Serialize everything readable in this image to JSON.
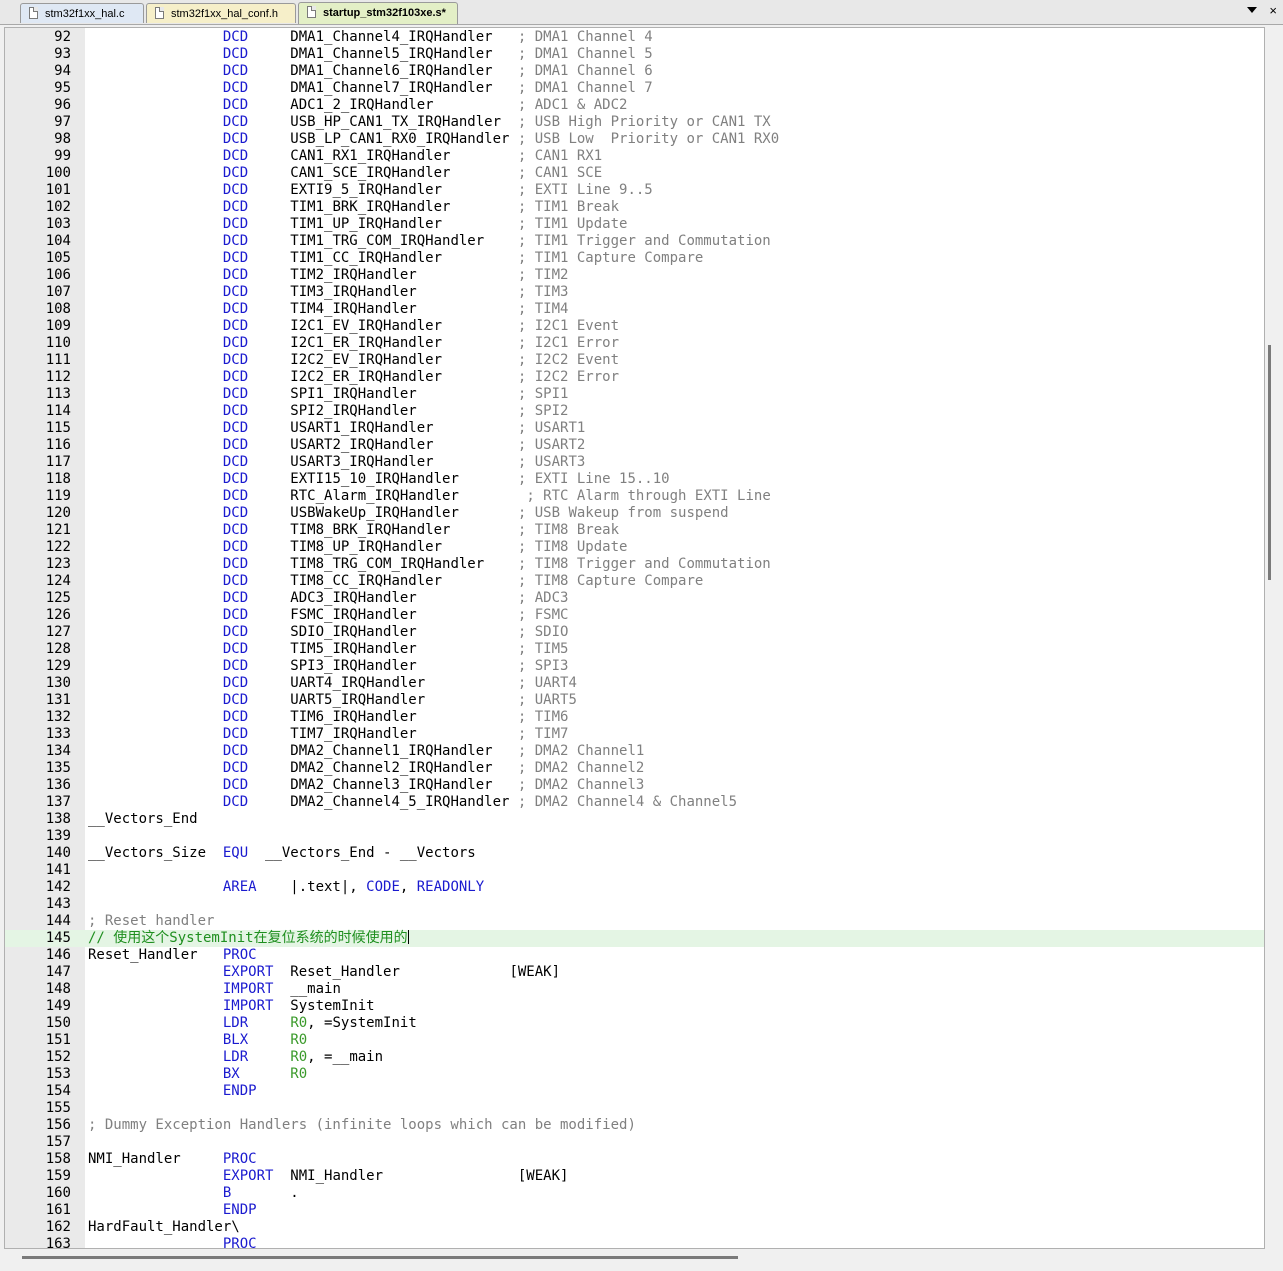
{
  "tabs": [
    {
      "label": "stm32f1xx_hal.c"
    },
    {
      "label": "stm32f1xx_hal_conf.h"
    },
    {
      "label": "startup_stm32f103xe.s*"
    }
  ],
  "current_line": 145,
  "lines": [
    {
      "n": "92",
      "s": [
        {
          "t": "                "
        },
        {
          "t": "DCD",
          "c": "kw"
        },
        {
          "t": "     DMA1_Channel4_IRQHandler   "
        },
        {
          "t": "; DMA1 Channel 4",
          "c": "cm"
        }
      ]
    },
    {
      "n": "93",
      "s": [
        {
          "t": "                "
        },
        {
          "t": "DCD",
          "c": "kw"
        },
        {
          "t": "     DMA1_Channel5_IRQHandler   "
        },
        {
          "t": "; DMA1 Channel 5",
          "c": "cm"
        }
      ]
    },
    {
      "n": "94",
      "s": [
        {
          "t": "                "
        },
        {
          "t": "DCD",
          "c": "kw"
        },
        {
          "t": "     DMA1_Channel6_IRQHandler   "
        },
        {
          "t": "; DMA1 Channel 6",
          "c": "cm"
        }
      ]
    },
    {
      "n": "95",
      "s": [
        {
          "t": "                "
        },
        {
          "t": "DCD",
          "c": "kw"
        },
        {
          "t": "     DMA1_Channel7_IRQHandler   "
        },
        {
          "t": "; DMA1 Channel 7",
          "c": "cm"
        }
      ]
    },
    {
      "n": "96",
      "s": [
        {
          "t": "                "
        },
        {
          "t": "DCD",
          "c": "kw"
        },
        {
          "t": "     ADC1_2_IRQHandler          "
        },
        {
          "t": "; ADC1 & ADC2",
          "c": "cm"
        }
      ]
    },
    {
      "n": "97",
      "s": [
        {
          "t": "                "
        },
        {
          "t": "DCD",
          "c": "kw"
        },
        {
          "t": "     USB_HP_CAN1_TX_IRQHandler  "
        },
        {
          "t": "; USB High Priority or CAN1 TX",
          "c": "cm"
        }
      ]
    },
    {
      "n": "98",
      "s": [
        {
          "t": "                "
        },
        {
          "t": "DCD",
          "c": "kw"
        },
        {
          "t": "     USB_LP_CAN1_RX0_IRQHandler "
        },
        {
          "t": "; USB Low  Priority or CAN1 RX0",
          "c": "cm"
        }
      ]
    },
    {
      "n": "99",
      "s": [
        {
          "t": "                "
        },
        {
          "t": "DCD",
          "c": "kw"
        },
        {
          "t": "     CAN1_RX1_IRQHandler        "
        },
        {
          "t": "; CAN1 RX1",
          "c": "cm"
        }
      ]
    },
    {
      "n": "100",
      "s": [
        {
          "t": "                "
        },
        {
          "t": "DCD",
          "c": "kw"
        },
        {
          "t": "     CAN1_SCE_IRQHandler        "
        },
        {
          "t": "; CAN1 SCE",
          "c": "cm"
        }
      ]
    },
    {
      "n": "101",
      "s": [
        {
          "t": "                "
        },
        {
          "t": "DCD",
          "c": "kw"
        },
        {
          "t": "     EXTI9_5_IRQHandler         "
        },
        {
          "t": "; EXTI Line 9..5",
          "c": "cm"
        }
      ]
    },
    {
      "n": "102",
      "s": [
        {
          "t": "                "
        },
        {
          "t": "DCD",
          "c": "kw"
        },
        {
          "t": "     TIM1_BRK_IRQHandler        "
        },
        {
          "t": "; TIM1 Break",
          "c": "cm"
        }
      ]
    },
    {
      "n": "103",
      "s": [
        {
          "t": "                "
        },
        {
          "t": "DCD",
          "c": "kw"
        },
        {
          "t": "     TIM1_UP_IRQHandler         "
        },
        {
          "t": "; TIM1 Update",
          "c": "cm"
        }
      ]
    },
    {
      "n": "104",
      "s": [
        {
          "t": "                "
        },
        {
          "t": "DCD",
          "c": "kw"
        },
        {
          "t": "     TIM1_TRG_COM_IRQHandler    "
        },
        {
          "t": "; TIM1 Trigger and Commutation",
          "c": "cm"
        }
      ]
    },
    {
      "n": "105",
      "s": [
        {
          "t": "                "
        },
        {
          "t": "DCD",
          "c": "kw"
        },
        {
          "t": "     TIM1_CC_IRQHandler         "
        },
        {
          "t": "; TIM1 Capture Compare",
          "c": "cm"
        }
      ]
    },
    {
      "n": "106",
      "s": [
        {
          "t": "                "
        },
        {
          "t": "DCD",
          "c": "kw"
        },
        {
          "t": "     TIM2_IRQHandler            "
        },
        {
          "t": "; TIM2",
          "c": "cm"
        }
      ]
    },
    {
      "n": "107",
      "s": [
        {
          "t": "                "
        },
        {
          "t": "DCD",
          "c": "kw"
        },
        {
          "t": "     TIM3_IRQHandler            "
        },
        {
          "t": "; TIM3",
          "c": "cm"
        }
      ]
    },
    {
      "n": "108",
      "s": [
        {
          "t": "                "
        },
        {
          "t": "DCD",
          "c": "kw"
        },
        {
          "t": "     TIM4_IRQHandler            "
        },
        {
          "t": "; TIM4",
          "c": "cm"
        }
      ]
    },
    {
      "n": "109",
      "s": [
        {
          "t": "                "
        },
        {
          "t": "DCD",
          "c": "kw"
        },
        {
          "t": "     I2C1_EV_IRQHandler         "
        },
        {
          "t": "; I2C1 Event",
          "c": "cm"
        }
      ]
    },
    {
      "n": "110",
      "s": [
        {
          "t": "                "
        },
        {
          "t": "DCD",
          "c": "kw"
        },
        {
          "t": "     I2C1_ER_IRQHandler         "
        },
        {
          "t": "; I2C1 Error",
          "c": "cm"
        }
      ]
    },
    {
      "n": "111",
      "s": [
        {
          "t": "                "
        },
        {
          "t": "DCD",
          "c": "kw"
        },
        {
          "t": "     I2C2_EV_IRQHandler         "
        },
        {
          "t": "; I2C2 Event",
          "c": "cm"
        }
      ]
    },
    {
      "n": "112",
      "s": [
        {
          "t": "                "
        },
        {
          "t": "DCD",
          "c": "kw"
        },
        {
          "t": "     I2C2_ER_IRQHandler         "
        },
        {
          "t": "; I2C2 Error",
          "c": "cm"
        }
      ]
    },
    {
      "n": "113",
      "s": [
        {
          "t": "                "
        },
        {
          "t": "DCD",
          "c": "kw"
        },
        {
          "t": "     SPI1_IRQHandler            "
        },
        {
          "t": "; SPI1",
          "c": "cm"
        }
      ]
    },
    {
      "n": "114",
      "s": [
        {
          "t": "                "
        },
        {
          "t": "DCD",
          "c": "kw"
        },
        {
          "t": "     SPI2_IRQHandler            "
        },
        {
          "t": "; SPI2",
          "c": "cm"
        }
      ]
    },
    {
      "n": "115",
      "s": [
        {
          "t": "                "
        },
        {
          "t": "DCD",
          "c": "kw"
        },
        {
          "t": "     USART1_IRQHandler          "
        },
        {
          "t": "; USART1",
          "c": "cm"
        }
      ]
    },
    {
      "n": "116",
      "s": [
        {
          "t": "                "
        },
        {
          "t": "DCD",
          "c": "kw"
        },
        {
          "t": "     USART2_IRQHandler          "
        },
        {
          "t": "; USART2",
          "c": "cm"
        }
      ]
    },
    {
      "n": "117",
      "s": [
        {
          "t": "                "
        },
        {
          "t": "DCD",
          "c": "kw"
        },
        {
          "t": "     USART3_IRQHandler          "
        },
        {
          "t": "; USART3",
          "c": "cm"
        }
      ]
    },
    {
      "n": "118",
      "s": [
        {
          "t": "                "
        },
        {
          "t": "DCD",
          "c": "kw"
        },
        {
          "t": "     EXTI15_10_IRQHandler       "
        },
        {
          "t": "; EXTI Line 15..10",
          "c": "cm"
        }
      ]
    },
    {
      "n": "119",
      "s": [
        {
          "t": "                "
        },
        {
          "t": "DCD",
          "c": "kw"
        },
        {
          "t": "     RTC_Alarm_IRQHandler        "
        },
        {
          "t": "; RTC Alarm through EXTI Line",
          "c": "cm"
        }
      ]
    },
    {
      "n": "120",
      "s": [
        {
          "t": "                "
        },
        {
          "t": "DCD",
          "c": "kw"
        },
        {
          "t": "     USBWakeUp_IRQHandler       "
        },
        {
          "t": "; USB Wakeup from suspend",
          "c": "cm"
        }
      ]
    },
    {
      "n": "121",
      "s": [
        {
          "t": "                "
        },
        {
          "t": "DCD",
          "c": "kw"
        },
        {
          "t": "     TIM8_BRK_IRQHandler        "
        },
        {
          "t": "; TIM8 Break",
          "c": "cm"
        }
      ]
    },
    {
      "n": "122",
      "s": [
        {
          "t": "                "
        },
        {
          "t": "DCD",
          "c": "kw"
        },
        {
          "t": "     TIM8_UP_IRQHandler         "
        },
        {
          "t": "; TIM8 Update",
          "c": "cm"
        }
      ]
    },
    {
      "n": "123",
      "s": [
        {
          "t": "                "
        },
        {
          "t": "DCD",
          "c": "kw"
        },
        {
          "t": "     TIM8_TRG_COM_IRQHandler    "
        },
        {
          "t": "; TIM8 Trigger and Commutation",
          "c": "cm"
        }
      ]
    },
    {
      "n": "124",
      "s": [
        {
          "t": "                "
        },
        {
          "t": "DCD",
          "c": "kw"
        },
        {
          "t": "     TIM8_CC_IRQHandler         "
        },
        {
          "t": "; TIM8 Capture Compare",
          "c": "cm"
        }
      ]
    },
    {
      "n": "125",
      "s": [
        {
          "t": "                "
        },
        {
          "t": "DCD",
          "c": "kw"
        },
        {
          "t": "     ADC3_IRQHandler            "
        },
        {
          "t": "; ADC3",
          "c": "cm"
        }
      ]
    },
    {
      "n": "126",
      "s": [
        {
          "t": "                "
        },
        {
          "t": "DCD",
          "c": "kw"
        },
        {
          "t": "     FSMC_IRQHandler            "
        },
        {
          "t": "; FSMC",
          "c": "cm"
        }
      ]
    },
    {
      "n": "127",
      "s": [
        {
          "t": "                "
        },
        {
          "t": "DCD",
          "c": "kw"
        },
        {
          "t": "     SDIO_IRQHandler            "
        },
        {
          "t": "; SDIO",
          "c": "cm"
        }
      ]
    },
    {
      "n": "128",
      "s": [
        {
          "t": "                "
        },
        {
          "t": "DCD",
          "c": "kw"
        },
        {
          "t": "     TIM5_IRQHandler            "
        },
        {
          "t": "; TIM5",
          "c": "cm"
        }
      ]
    },
    {
      "n": "129",
      "s": [
        {
          "t": "                "
        },
        {
          "t": "DCD",
          "c": "kw"
        },
        {
          "t": "     SPI3_IRQHandler            "
        },
        {
          "t": "; SPI3",
          "c": "cm"
        }
      ]
    },
    {
      "n": "130",
      "s": [
        {
          "t": "                "
        },
        {
          "t": "DCD",
          "c": "kw"
        },
        {
          "t": "     UART4_IRQHandler           "
        },
        {
          "t": "; UART4",
          "c": "cm"
        }
      ]
    },
    {
      "n": "131",
      "s": [
        {
          "t": "                "
        },
        {
          "t": "DCD",
          "c": "kw"
        },
        {
          "t": "     UART5_IRQHandler           "
        },
        {
          "t": "; UART5",
          "c": "cm"
        }
      ]
    },
    {
      "n": "132",
      "s": [
        {
          "t": "                "
        },
        {
          "t": "DCD",
          "c": "kw"
        },
        {
          "t": "     TIM6_IRQHandler            "
        },
        {
          "t": "; TIM6",
          "c": "cm"
        }
      ]
    },
    {
      "n": "133",
      "s": [
        {
          "t": "                "
        },
        {
          "t": "DCD",
          "c": "kw"
        },
        {
          "t": "     TIM7_IRQHandler            "
        },
        {
          "t": "; TIM7",
          "c": "cm"
        }
      ]
    },
    {
      "n": "134",
      "s": [
        {
          "t": "                "
        },
        {
          "t": "DCD",
          "c": "kw"
        },
        {
          "t": "     DMA2_Channel1_IRQHandler   "
        },
        {
          "t": "; DMA2 Channel1",
          "c": "cm"
        }
      ]
    },
    {
      "n": "135",
      "s": [
        {
          "t": "                "
        },
        {
          "t": "DCD",
          "c": "kw"
        },
        {
          "t": "     DMA2_Channel2_IRQHandler   "
        },
        {
          "t": "; DMA2 Channel2",
          "c": "cm"
        }
      ]
    },
    {
      "n": "136",
      "s": [
        {
          "t": "                "
        },
        {
          "t": "DCD",
          "c": "kw"
        },
        {
          "t": "     DMA2_Channel3_IRQHandler   "
        },
        {
          "t": "; DMA2 Channel3",
          "c": "cm"
        }
      ]
    },
    {
      "n": "137",
      "s": [
        {
          "t": "                "
        },
        {
          "t": "DCD",
          "c": "kw"
        },
        {
          "t": "     DMA2_Channel4_5_IRQHandler "
        },
        {
          "t": "; DMA2 Channel4 & Channel5",
          "c": "cm"
        }
      ]
    },
    {
      "n": "138",
      "s": [
        {
          "t": "__Vectors_End"
        }
      ]
    },
    {
      "n": "139",
      "s": []
    },
    {
      "n": "140",
      "s": [
        {
          "t": "__Vectors_Size  "
        },
        {
          "t": "EQU",
          "c": "kw"
        },
        {
          "t": "  __Vectors_End - __Vectors"
        }
      ]
    },
    {
      "n": "141",
      "s": []
    },
    {
      "n": "142",
      "s": [
        {
          "t": "                "
        },
        {
          "t": "AREA",
          "c": "kw"
        },
        {
          "t": "    |.text|, "
        },
        {
          "t": "CODE",
          "c": "kw"
        },
        {
          "t": ", "
        },
        {
          "t": "READONLY",
          "c": "kw"
        }
      ]
    },
    {
      "n": "143",
      "s": []
    },
    {
      "n": "144",
      "s": [
        {
          "t": "; Reset handler",
          "c": "cm"
        }
      ]
    },
    {
      "n": "145",
      "s": [
        {
          "t": "// 使用这个SystemInit在复位系统的时候使用的",
          "c": "cmc"
        }
      ]
    },
    {
      "n": "146",
      "s": [
        {
          "t": "Reset_Handler   "
        },
        {
          "t": "PROC",
          "c": "kw"
        }
      ]
    },
    {
      "n": "147",
      "s": [
        {
          "t": "                "
        },
        {
          "t": "EXPORT",
          "c": "kw"
        },
        {
          "t": "  Reset_Handler             [WEAK]"
        }
      ]
    },
    {
      "n": "148",
      "s": [
        {
          "t": "                "
        },
        {
          "t": "IMPORT",
          "c": "kw"
        },
        {
          "t": "  __main"
        }
      ]
    },
    {
      "n": "149",
      "s": [
        {
          "t": "                "
        },
        {
          "t": "IMPORT",
          "c": "kw"
        },
        {
          "t": "  SystemInit"
        }
      ]
    },
    {
      "n": "150",
      "s": [
        {
          "t": "                "
        },
        {
          "t": "LDR",
          "c": "kw"
        },
        {
          "t": "     "
        },
        {
          "t": "R0",
          "c": "rg"
        },
        {
          "t": ", =SystemInit"
        }
      ]
    },
    {
      "n": "151",
      "s": [
        {
          "t": "                "
        },
        {
          "t": "BLX",
          "c": "kw"
        },
        {
          "t": "     "
        },
        {
          "t": "R0",
          "c": "rg"
        }
      ]
    },
    {
      "n": "152",
      "s": [
        {
          "t": "                "
        },
        {
          "t": "LDR",
          "c": "kw"
        },
        {
          "t": "     "
        },
        {
          "t": "R0",
          "c": "rg"
        },
        {
          "t": ", =__main"
        }
      ]
    },
    {
      "n": "153",
      "s": [
        {
          "t": "                "
        },
        {
          "t": "BX",
          "c": "kw"
        },
        {
          "t": "      "
        },
        {
          "t": "R0",
          "c": "rg"
        }
      ]
    },
    {
      "n": "154",
      "s": [
        {
          "t": "                "
        },
        {
          "t": "ENDP",
          "c": "kw"
        }
      ]
    },
    {
      "n": "155",
      "s": []
    },
    {
      "n": "156",
      "s": [
        {
          "t": "; Dummy Exception Handlers (infinite loops which can be modified)",
          "c": "cm"
        }
      ]
    },
    {
      "n": "157",
      "s": []
    },
    {
      "n": "158",
      "s": [
        {
          "t": "NMI_Handler     "
        },
        {
          "t": "PROC",
          "c": "kw"
        }
      ]
    },
    {
      "n": "159",
      "s": [
        {
          "t": "                "
        },
        {
          "t": "EXPORT",
          "c": "kw"
        },
        {
          "t": "  NMI_Handler                [WEAK]"
        }
      ]
    },
    {
      "n": "160",
      "s": [
        {
          "t": "                "
        },
        {
          "t": "B",
          "c": "kw"
        },
        {
          "t": "       ."
        }
      ]
    },
    {
      "n": "161",
      "s": [
        {
          "t": "                "
        },
        {
          "t": "ENDP",
          "c": "kw"
        }
      ]
    },
    {
      "n": "162",
      "s": [
        {
          "t": "HardFault_Handler\\"
        }
      ]
    },
    {
      "n": "163",
      "s": [
        {
          "t": "                "
        },
        {
          "t": "PROC",
          "c": "kw"
        }
      ]
    }
  ]
}
